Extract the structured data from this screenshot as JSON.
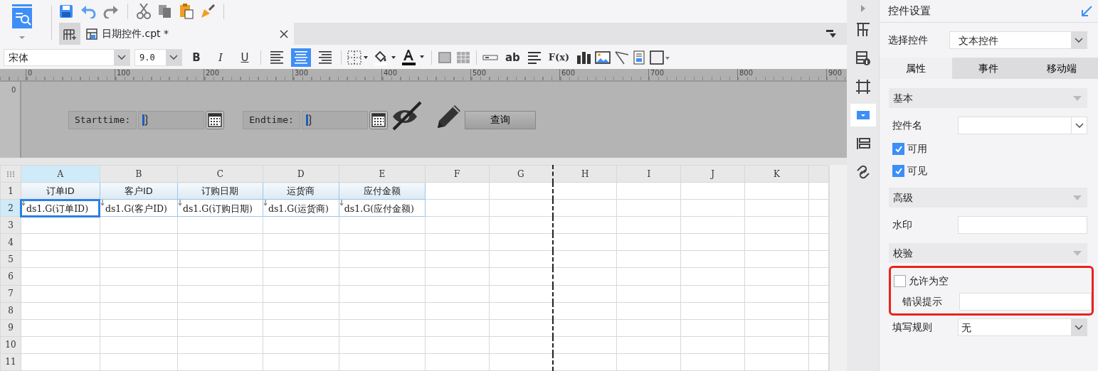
{
  "document_tabs": [
    {
      "label": "日期控件.cpt *",
      "selected": true
    }
  ],
  "format_bar": {
    "font": "宋体",
    "size": "9.0",
    "style_buttons": [
      {
        "label": "B",
        "kind": "bold"
      },
      {
        "label": "I",
        "kind": "italic"
      },
      {
        "label": "U",
        "kind": "underline"
      }
    ],
    "alignment": [
      {
        "selected": false
      },
      {
        "selected": true
      },
      {
        "selected": false
      }
    ],
    "text_buttons": [
      {
        "label": "ab"
      },
      {
        "label": "F(x)"
      }
    ]
  },
  "ruler": {
    "marks": [
      "0",
      "100",
      "200",
      "300",
      "400",
      "500",
      "600",
      "700",
      "800",
      "900"
    ],
    "vertical_mark": "0"
  },
  "parameters": {
    "fields": [
      {
        "label": "Starttime:"
      },
      {
        "label": "Endtime:"
      }
    ],
    "button": "查询"
  },
  "grid": {
    "columns": [
      {
        "label": "A",
        "selected": true
      },
      {
        "label": "B",
        "selected": false
      },
      {
        "label": "C",
        "selected": false
      },
      {
        "label": "D",
        "selected": false
      },
      {
        "label": "E",
        "selected": false
      },
      {
        "label": "F",
        "selected": false
      },
      {
        "label": "G",
        "selected": false
      },
      {
        "label": "H",
        "selected": false
      },
      {
        "label": "I",
        "selected": false
      },
      {
        "label": "J",
        "selected": false
      },
      {
        "label": "K",
        "selected": false
      }
    ],
    "rows": [
      {
        "label": "1",
        "selected": false,
        "cells": [
          {
            "text": "订单ID",
            "kind": "header",
            "selected": false
          },
          {
            "text": "客户ID",
            "kind": "header",
            "selected": false
          },
          {
            "text": "订购日期",
            "kind": "header",
            "selected": false
          },
          {
            "text": "运货商",
            "kind": "header",
            "selected": false
          },
          {
            "text": "应付金额",
            "kind": "header",
            "selected": false
          }
        ]
      },
      {
        "label": "2",
        "selected": true,
        "cells": [
          {
            "text": "ds1.G(订单ID)",
            "kind": "expand",
            "selected": true
          },
          {
            "text": "ds1.G(客户ID)",
            "kind": "expand",
            "selected": false
          },
          {
            "text": "ds1.G(订购日期)",
            "kind": "expand",
            "selected": false
          },
          {
            "text": "ds1.G(运货商)",
            "kind": "expand",
            "selected": false
          },
          {
            "text": "ds1.G(应付金额)",
            "kind": "expand",
            "selected": false
          }
        ]
      },
      {
        "label": "3",
        "selected": false,
        "cells": []
      },
      {
        "label": "4",
        "selected": false,
        "cells": []
      },
      {
        "label": "5",
        "selected": false,
        "cells": []
      },
      {
        "label": "6",
        "selected": false,
        "cells": []
      },
      {
        "label": "7",
        "selected": false,
        "cells": []
      },
      {
        "label": "8",
        "selected": false,
        "cells": []
      },
      {
        "label": "9",
        "selected": false,
        "cells": []
      },
      {
        "label": "10",
        "selected": false,
        "cells": []
      },
      {
        "label": "11",
        "selected": false,
        "cells": []
      }
    ]
  },
  "side_strip": {
    "items": [
      {
        "selected": false
      },
      {
        "selected": false
      },
      {
        "selected": false
      },
      {
        "selected": true
      },
      {
        "selected": false
      },
      {
        "selected": false
      }
    ]
  },
  "settings_panel": {
    "title": "控件设置",
    "picker": {
      "label": "选择控件",
      "value": "文本控件"
    },
    "tabs": [
      {
        "label": "属性",
        "selected": true
      },
      {
        "label": "事件",
        "selected": false
      },
      {
        "label": "移动端",
        "selected": false
      }
    ],
    "sections": [
      {
        "title": "基本",
        "items": [
          {
            "kind": "combo",
            "label": "控件名"
          },
          {
            "kind": "checkbox",
            "label": "可用",
            "checked": true
          },
          {
            "kind": "checkbox",
            "label": "可见",
            "checked": true
          }
        ]
      },
      {
        "title": "高级",
        "items": [
          {
            "kind": "text",
            "label": "水印"
          }
        ]
      },
      {
        "title": "校验",
        "highlighted": true,
        "items": [
          {
            "kind": "checkbox",
            "label": "允许为空",
            "checked": false
          },
          {
            "kind": "text",
            "label": "错误提示"
          }
        ]
      }
    ],
    "rule": {
      "label": "填写规则",
      "value": "无"
    }
  }
}
